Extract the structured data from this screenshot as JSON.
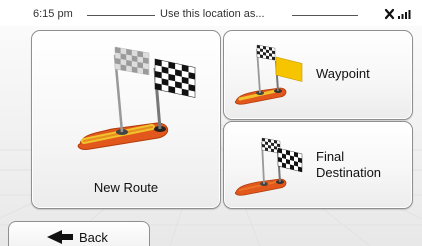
{
  "status": {
    "time": "6:15 pm",
    "title": "Use this location as..."
  },
  "tiles": [
    {
      "label": "New Route",
      "icon": "checkered-flags-route-icon"
    },
    {
      "label": "Waypoint",
      "icon": "waypoint-flag-icon"
    },
    {
      "label": "Final\nDestination",
      "icon": "final-destination-flag-icon"
    }
  ],
  "back": {
    "label": "Back",
    "icon": "back-arrow-icon"
  },
  "colors": {
    "route_orange": "#e2571b",
    "route_yellow": "#f2c12e",
    "waypoint_flag": "#f7c400"
  }
}
